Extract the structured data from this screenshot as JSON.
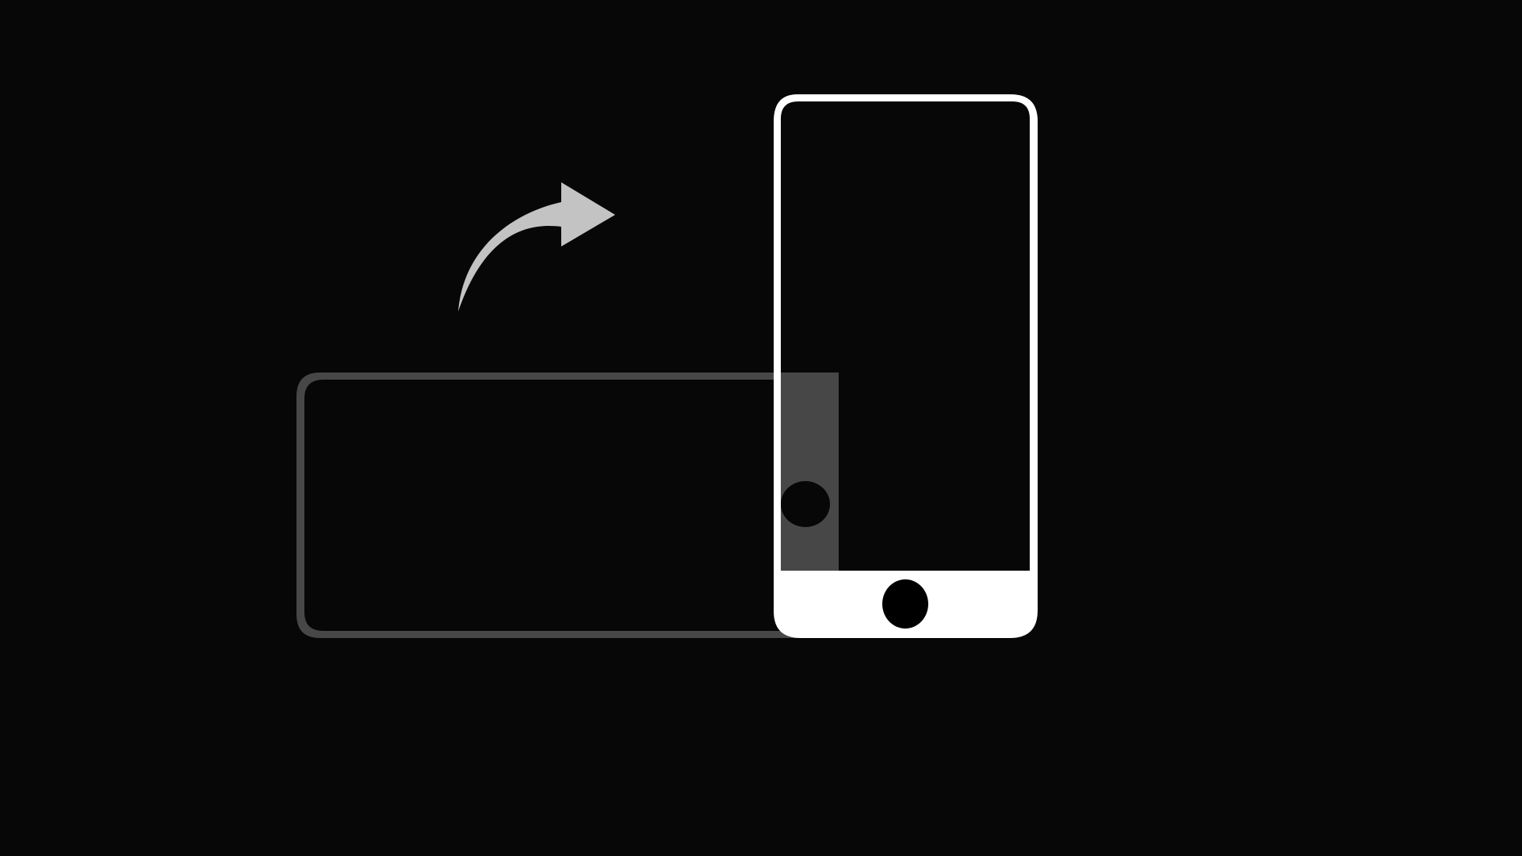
{
  "screen": {
    "background_color": "#070707",
    "type": "rotate-device-prompt"
  },
  "illustration": {
    "landscape_phone": {
      "icon": "landscape-phone-icon",
      "color": "#474747"
    },
    "portrait_phone": {
      "icon": "portrait-phone-icon",
      "color": "#ffffff"
    },
    "rotate_arrow": {
      "icon": "rotate-arrow-icon",
      "color": "#c3c3c3"
    }
  }
}
